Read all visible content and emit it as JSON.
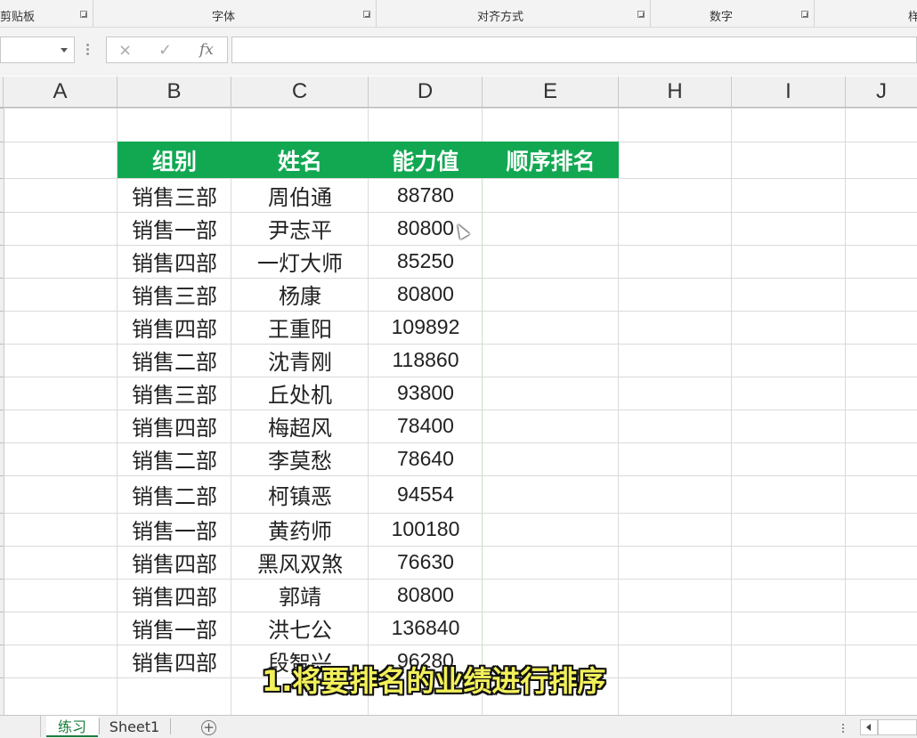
{
  "ribbon": {
    "groups": [
      "剪贴板",
      "字体",
      "对齐方式",
      "数字",
      "样"
    ]
  },
  "formula_bar": {
    "name_box": "",
    "cancel_icon": "×",
    "enter_icon": "✓",
    "fx_label": "fx",
    "content": ""
  },
  "columns": [
    "A",
    "B",
    "C",
    "D",
    "E",
    "H",
    "I",
    "J"
  ],
  "table": {
    "headers": [
      "组别",
      "姓名",
      "能力值",
      "顺序排名"
    ],
    "rows": [
      {
        "group": "销售三部",
        "name": "周伯通",
        "value": "88780"
      },
      {
        "group": "销售一部",
        "name": "尹志平",
        "value": "80800"
      },
      {
        "group": "销售四部",
        "name": "一灯大师",
        "value": "85250"
      },
      {
        "group": "销售三部",
        "name": "杨康",
        "value": "80800"
      },
      {
        "group": "销售四部",
        "name": "王重阳",
        "value": "109892"
      },
      {
        "group": "销售二部",
        "name": "沈青刚",
        "value": "118860"
      },
      {
        "group": "销售三部",
        "name": "丘处机",
        "value": "93800"
      },
      {
        "group": "销售四部",
        "name": "梅超风",
        "value": "78400"
      },
      {
        "group": "销售二部",
        "name": "李莫愁",
        "value": "78640"
      },
      {
        "group": "销售二部",
        "name": "柯镇恶",
        "value": "94554"
      },
      {
        "group": "销售一部",
        "name": "黄药师",
        "value": "100180"
      },
      {
        "group": "销售四部",
        "name": "黑风双煞",
        "value": "76630"
      },
      {
        "group": "销售四部",
        "name": "郭靖",
        "value": "80800"
      },
      {
        "group": "销售一部",
        "name": "洪七公",
        "value": "136840"
      },
      {
        "group": "销售四部",
        "name": "段智兴",
        "value": "96280"
      }
    ]
  },
  "caption": "1.将要排名的业绩进行排序",
  "sheet_tabs": [
    "练习",
    "Sheet1"
  ],
  "active_tab": "练习",
  "add_sheet_icon": "+",
  "colors": {
    "header_fill": "#12a852",
    "header_text": "#ffffff",
    "active_tab_text": "#1a7d3c",
    "caption_text": "#f2f05a"
  }
}
